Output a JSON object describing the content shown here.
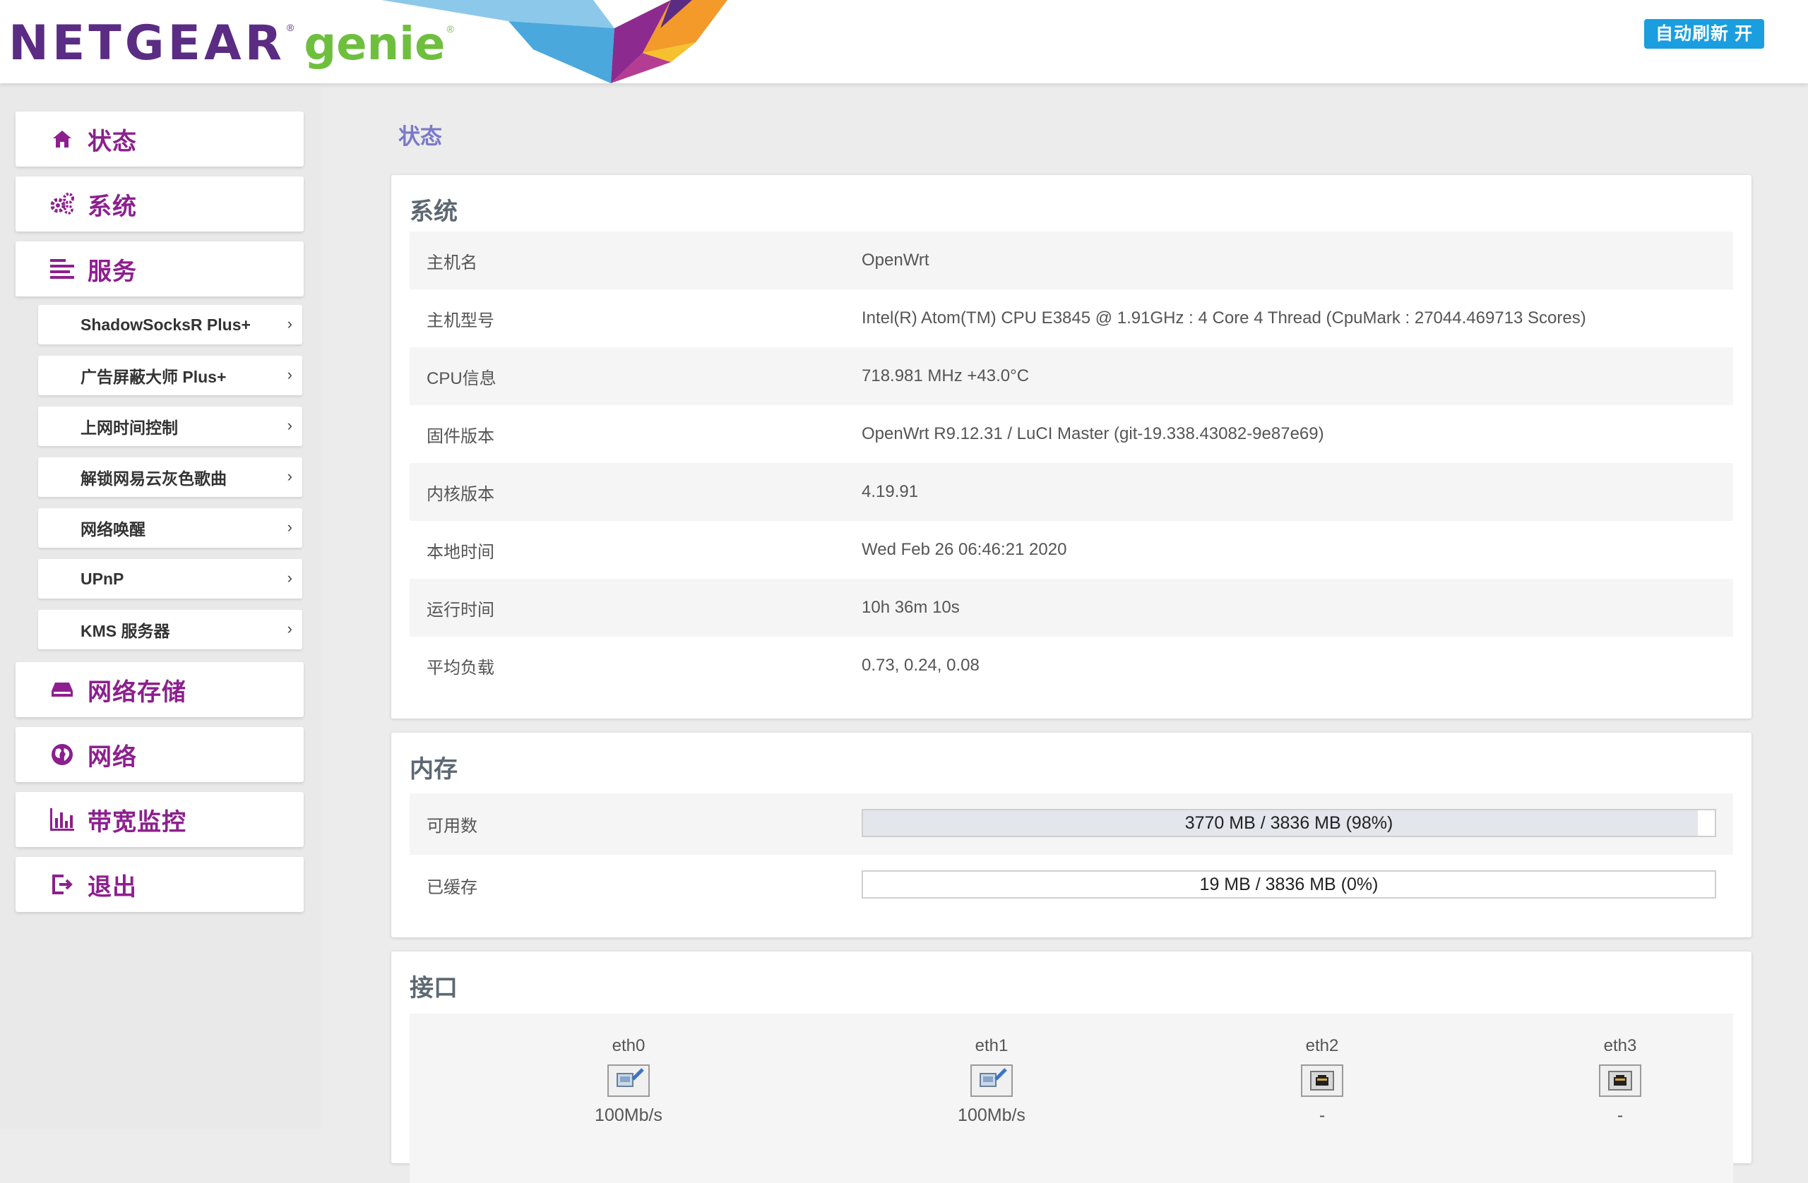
{
  "header": {
    "brand_main": "NETGEAR",
    "brand_sub": "genie",
    "registered_mark": "®",
    "auto_refresh_label": "自动刷新 开"
  },
  "sidebar": {
    "items": [
      {
        "label": "状态",
        "icon": "home-icon"
      },
      {
        "label": "系统",
        "icon": "gears-icon"
      },
      {
        "label": "服务",
        "icon": "list-icon"
      }
    ],
    "sub_items": [
      {
        "label": "ShadowSocksR Plus+"
      },
      {
        "label": "广告屏蔽大师 Plus+"
      },
      {
        "label": "上网时间控制"
      },
      {
        "label": "解锁网易云灰色歌曲"
      },
      {
        "label": "网络唤醒"
      },
      {
        "label": "UPnP"
      },
      {
        "label": "KMS 服务器"
      }
    ],
    "items_after": [
      {
        "label": "网络存储",
        "icon": "drive-icon"
      },
      {
        "label": "网络",
        "icon": "globe-icon"
      },
      {
        "label": "带宽监控",
        "icon": "bar-chart-icon"
      },
      {
        "label": "退出",
        "icon": "logout-icon"
      }
    ],
    "chevron": "›"
  },
  "main": {
    "page_title": "状态",
    "system": {
      "title": "系统",
      "rows": [
        {
          "key": "主机名",
          "value": "OpenWrt"
        },
        {
          "key": "主机型号",
          "value": "Intel(R) Atom(TM) CPU E3845 @ 1.91GHz : 4 Core 4 Thread (CpuMark : 27044.469713 Scores)"
        },
        {
          "key": "CPU信息",
          "value": "718.981 MHz +43.0°C"
        },
        {
          "key": "固件版本",
          "value": "OpenWrt R9.12.31 / LuCI Master (git-19.338.43082-9e87e69)"
        },
        {
          "key": "内核版本",
          "value": "4.19.91"
        },
        {
          "key": "本地时间",
          "value": "Wed Feb 26 06:46:21 2020"
        },
        {
          "key": "运行时间",
          "value": "10h 36m 10s"
        },
        {
          "key": "平均负载",
          "value": "0.73, 0.24, 0.08"
        }
      ]
    },
    "memory": {
      "title": "内存",
      "rows": [
        {
          "key": "可用数",
          "value": "3770 MB / 3836 MB (98%)",
          "percent": 98
        },
        {
          "key": "已缓存",
          "value": "19 MB / 3836 MB (0%)",
          "percent": 0
        }
      ]
    },
    "interfaces": {
      "title": "接口",
      "items": [
        {
          "name": "eth0",
          "speed": "100Mb/s",
          "connected": true
        },
        {
          "name": "eth1",
          "speed": "100Mb/s",
          "connected": true
        },
        {
          "name": "eth2",
          "speed": "-",
          "connected": false
        },
        {
          "name": "eth3",
          "speed": "-",
          "connected": false
        }
      ]
    }
  },
  "colors": {
    "brand_purple": "#5b2c83",
    "brand_green": "#6fbf3e",
    "menu_text": "#8d1f8f",
    "accent_blue": "#1a9ee0",
    "page_title": "#7b79c9"
  }
}
